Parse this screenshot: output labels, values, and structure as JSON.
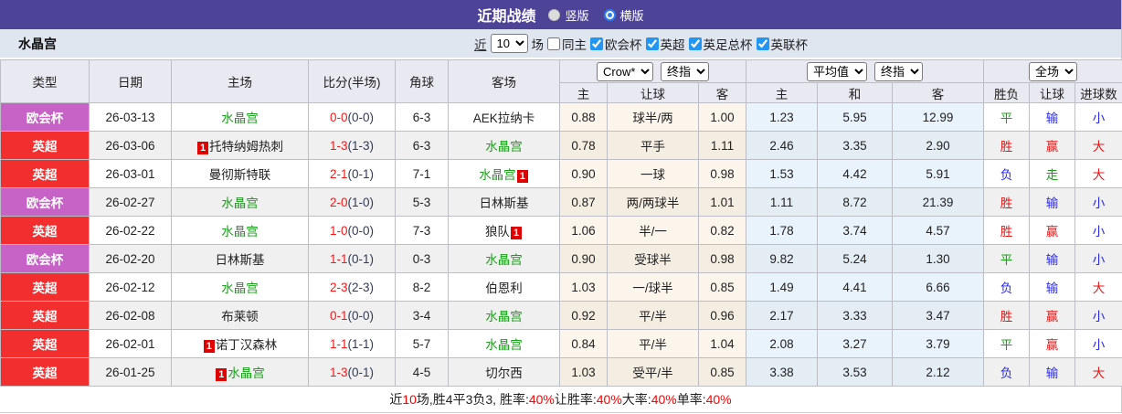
{
  "titlebar": {
    "title": "近期战绩",
    "vertical_label": "竖版",
    "horizontal_label": "横版"
  },
  "filterbar": {
    "team_name": "水晶宫",
    "near_label": "近",
    "rounds_value": "10",
    "games_label": "场",
    "same_home_label": "同主",
    "leagues": [
      {
        "label": "欧会杯",
        "checked_attr": "checked"
      },
      {
        "label": "英超",
        "checked_attr": "checked"
      },
      {
        "label": "英足总杯",
        "checked_attr": "checked"
      },
      {
        "label": "英联杯",
        "checked_attr": "checked"
      }
    ]
  },
  "table": {
    "selects": {
      "odds_source": "Crow*",
      "odds_final": "终指",
      "avg_source": "平均值",
      "avg_final": "终指",
      "scope": "全场"
    },
    "headers": {
      "type": "类型",
      "date": "日期",
      "home": "主场",
      "score": "比分(半场)",
      "corner": "角球",
      "away": "客场",
      "odds_home": "主",
      "odds_handicap": "让球",
      "odds_away": "客",
      "avg_home": "主",
      "avg_draw": "和",
      "avg_away": "客",
      "outcome": "胜负",
      "handicap_result": "让球",
      "goals": "进球数"
    },
    "rows": [
      {
        "league": "欧会杯",
        "league_color": "purple",
        "date": "26-03-13",
        "home": {
          "pre": "",
          "name": "水晶宫",
          "post": "",
          "color": "green"
        },
        "score_ft": "0-0",
        "score_ht": "(0-0)",
        "corner": "6-3",
        "away": {
          "pre": "",
          "name": "AEK拉纳卡",
          "post": "",
          "color": "black"
        },
        "odds": {
          "home": "0.88",
          "handicap": "球半/两",
          "away": "1.00"
        },
        "avg": {
          "home": "1.23",
          "draw": "5.95",
          "away": "12.99"
        },
        "result": {
          "outcome": "平",
          "outcome_color": "green",
          "handicap": "输",
          "handicap_color": "blue",
          "goals": "小",
          "goals_color": "blue"
        }
      },
      {
        "league": "英超",
        "league_color": "red",
        "date": "26-03-06",
        "home": {
          "pre": "1",
          "name": "托特纳姆热刺",
          "post": "",
          "color": "black"
        },
        "score_ft": "1-3",
        "score_ht": "(1-3)",
        "corner": "6-3",
        "away": {
          "pre": "",
          "name": "水晶宫",
          "post": "",
          "color": "green"
        },
        "odds": {
          "home": "0.78",
          "handicap": "平手",
          "away": "1.11"
        },
        "avg": {
          "home": "2.46",
          "draw": "3.35",
          "away": "2.90"
        },
        "result": {
          "outcome": "胜",
          "outcome_color": "red",
          "handicap": "赢",
          "handicap_color": "red",
          "goals": "大",
          "goals_color": "red"
        }
      },
      {
        "league": "英超",
        "league_color": "red",
        "date": "26-03-01",
        "home": {
          "pre": "",
          "name": "曼彻斯特联",
          "post": "",
          "color": "black"
        },
        "score_ft": "2-1",
        "score_ht": "(0-1)",
        "corner": "7-1",
        "away": {
          "pre": "",
          "name": "水晶宫",
          "post": "1",
          "color": "green"
        },
        "odds": {
          "home": "0.90",
          "handicap": "一球",
          "away": "0.98"
        },
        "avg": {
          "home": "1.53",
          "draw": "4.42",
          "away": "5.91"
        },
        "result": {
          "outcome": "负",
          "outcome_color": "blue",
          "handicap": "走",
          "handicap_color": "green",
          "goals": "大",
          "goals_color": "red"
        }
      },
      {
        "league": "欧会杯",
        "league_color": "purple",
        "date": "26-02-27",
        "home": {
          "pre": "",
          "name": "水晶宫",
          "post": "",
          "color": "green"
        },
        "score_ft": "2-0",
        "score_ht": "(1-0)",
        "corner": "5-3",
        "away": {
          "pre": "",
          "name": "日林斯基",
          "post": "",
          "color": "black"
        },
        "odds": {
          "home": "0.87",
          "handicap": "两/两球半",
          "away": "1.01"
        },
        "avg": {
          "home": "1.11",
          "draw": "8.72",
          "away": "21.39"
        },
        "result": {
          "outcome": "胜",
          "outcome_color": "red",
          "handicap": "输",
          "handicap_color": "blue",
          "goals": "小",
          "goals_color": "blue"
        }
      },
      {
        "league": "英超",
        "league_color": "red",
        "date": "26-02-22",
        "home": {
          "pre": "",
          "name": "水晶宫",
          "post": "",
          "color": "green"
        },
        "score_ft": "1-0",
        "score_ht": "(0-0)",
        "corner": "7-3",
        "away": {
          "pre": "",
          "name": "狼队",
          "post": "1",
          "color": "black"
        },
        "odds": {
          "home": "1.06",
          "handicap": "半/一",
          "away": "0.82"
        },
        "avg": {
          "home": "1.78",
          "draw": "3.74",
          "away": "4.57"
        },
        "result": {
          "outcome": "胜",
          "outcome_color": "red",
          "handicap": "赢",
          "handicap_color": "red",
          "goals": "小",
          "goals_color": "blue"
        }
      },
      {
        "league": "欧会杯",
        "league_color": "purple",
        "date": "26-02-20",
        "home": {
          "pre": "",
          "name": "日林斯基",
          "post": "",
          "color": "black"
        },
        "score_ft": "1-1",
        "score_ht": "(0-1)",
        "corner": "0-3",
        "away": {
          "pre": "",
          "name": "水晶宫",
          "post": "",
          "color": "green"
        },
        "odds": {
          "home": "0.90",
          "handicap": "受球半",
          "away": "0.98"
        },
        "avg": {
          "home": "9.82",
          "draw": "5.24",
          "away": "1.30"
        },
        "result": {
          "outcome": "平",
          "outcome_color": "green",
          "handicap": "输",
          "handicap_color": "blue",
          "goals": "小",
          "goals_color": "blue"
        }
      },
      {
        "league": "英超",
        "league_color": "red",
        "date": "26-02-12",
        "home": {
          "pre": "",
          "name": "水晶宫",
          "post": "",
          "color": "green"
        },
        "score_ft": "2-3",
        "score_ht": "(2-3)",
        "corner": "8-2",
        "away": {
          "pre": "",
          "name": "伯恩利",
          "post": "",
          "color": "black"
        },
        "odds": {
          "home": "1.03",
          "handicap": "一/球半",
          "away": "0.85"
        },
        "avg": {
          "home": "1.49",
          "draw": "4.41",
          "away": "6.66"
        },
        "result": {
          "outcome": "负",
          "outcome_color": "blue",
          "handicap": "输",
          "handicap_color": "blue",
          "goals": "大",
          "goals_color": "red"
        }
      },
      {
        "league": "英超",
        "league_color": "red",
        "date": "26-02-08",
        "home": {
          "pre": "",
          "name": "布莱顿",
          "post": "",
          "color": "black"
        },
        "score_ft": "0-1",
        "score_ht": "(0-0)",
        "corner": "3-4",
        "away": {
          "pre": "",
          "name": "水晶宫",
          "post": "",
          "color": "green"
        },
        "odds": {
          "home": "0.92",
          "handicap": "平/半",
          "away": "0.96"
        },
        "avg": {
          "home": "2.17",
          "draw": "3.33",
          "away": "3.47"
        },
        "result": {
          "outcome": "胜",
          "outcome_color": "red",
          "handicap": "赢",
          "handicap_color": "red",
          "goals": "小",
          "goals_color": "blue"
        }
      },
      {
        "league": "英超",
        "league_color": "red",
        "date": "26-02-01",
        "home": {
          "pre": "1",
          "name": "诺丁汉森林",
          "post": "",
          "color": "black"
        },
        "score_ft": "1-1",
        "score_ht": "(1-1)",
        "corner": "5-7",
        "away": {
          "pre": "",
          "name": "水晶宫",
          "post": "",
          "color": "green"
        },
        "odds": {
          "home": "0.84",
          "handicap": "平/半",
          "away": "1.04"
        },
        "avg": {
          "home": "2.08",
          "draw": "3.27",
          "away": "3.79"
        },
        "result": {
          "outcome": "平",
          "outcome_color": "green",
          "handicap": "赢",
          "handicap_color": "red",
          "goals": "小",
          "goals_color": "blue"
        }
      },
      {
        "league": "英超",
        "league_color": "red",
        "date": "26-01-25",
        "home": {
          "pre": "1",
          "name": "水晶宫",
          "post": "",
          "color": "green"
        },
        "score_ft": "1-3",
        "score_ht": "(0-1)",
        "corner": "4-5",
        "away": {
          "pre": "",
          "name": "切尔西",
          "post": "",
          "color": "black"
        },
        "odds": {
          "home": "1.03",
          "handicap": "受平/半",
          "away": "0.85"
        },
        "avg": {
          "home": "3.38",
          "draw": "3.53",
          "away": "2.12"
        },
        "result": {
          "outcome": "负",
          "outcome_color": "blue",
          "handicap": "输",
          "handicap_color": "blue",
          "goals": "大",
          "goals_color": "red"
        }
      }
    ]
  },
  "footer": {
    "segments": [
      {
        "t": "近",
        "c": "black"
      },
      {
        "t": "10",
        "c": "red"
      },
      {
        "t": "场,胜4平3负3, 胜率:",
        "c": "black"
      },
      {
        "t": "40%",
        "c": "red"
      },
      {
        "t": " 让胜率:",
        "c": "black"
      },
      {
        "t": "40%",
        "c": "red"
      },
      {
        "t": " 大率:",
        "c": "black"
      },
      {
        "t": "40%",
        "c": "red"
      },
      {
        "t": " 单率:",
        "c": "black"
      },
      {
        "t": "40%",
        "c": "red"
      }
    ]
  }
}
